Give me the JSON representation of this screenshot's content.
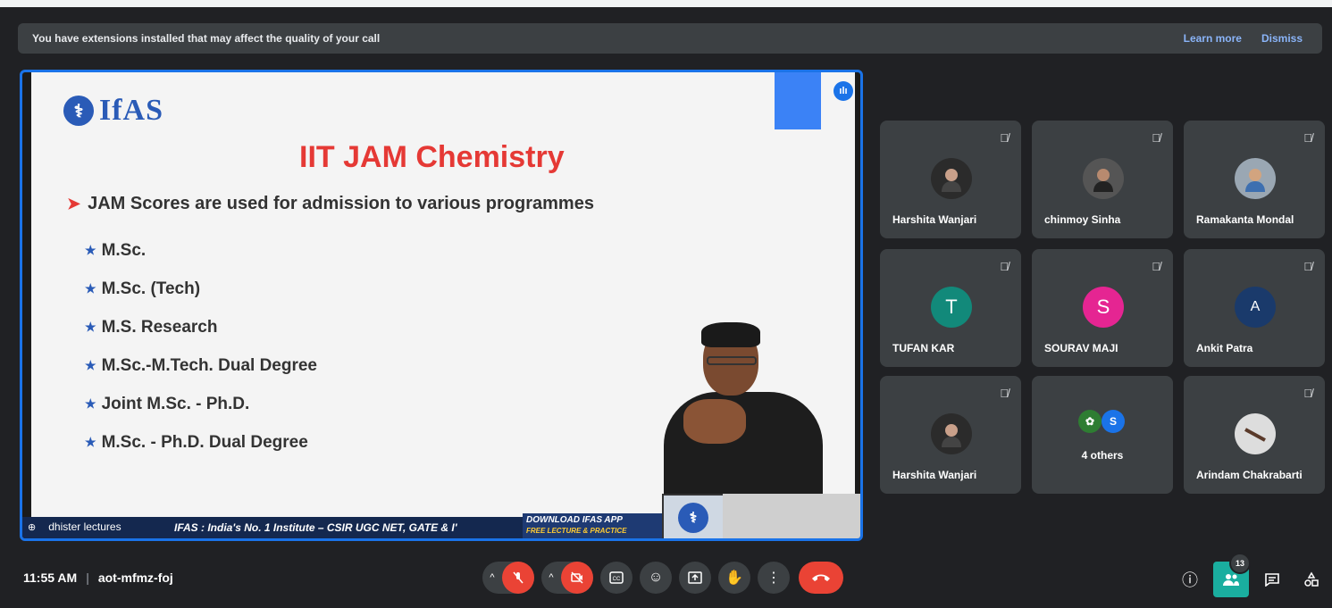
{
  "banner": {
    "message": "You have extensions installed that may affect the quality of your call",
    "learn_more": "Learn more",
    "dismiss": "Dismiss"
  },
  "presentation": {
    "logo_mark": "⚕",
    "logo_text": "IfAS",
    "title": "IIT JAM Chemistry",
    "lead": "JAM Scores are used for admission to various programmes",
    "bullets": [
      "M.Sc.",
      "M.Sc. (Tech)",
      "M.S. Research",
      "M.Sc.-M.Tech. Dual Degree",
      "Joint M.Sc. - Ph.D.",
      "M.Sc. - Ph.D. Dual Degree"
    ],
    "ticker": "IFAS : India's No. 1 Institute – CSIR UGC NET, GATE & I'",
    "app_line1": "DOWNLOAD IFAS APP",
    "app_line2": "FREE LECTURE & PRACTICE QUESTIONS",
    "presenter_name": "dhister lectures"
  },
  "participants": [
    {
      "name": "Harshita Wanjari",
      "avatar": "",
      "color": "#2b2b2b"
    },
    {
      "name": "chinmoy Sinha",
      "avatar": "",
      "color": "#555555"
    },
    {
      "name": "Ramakanta Mondal",
      "avatar": "",
      "color": "#9aa7b3"
    },
    {
      "name": "TUFAN KAR",
      "avatar": "T",
      "color": "#12897a"
    },
    {
      "name": "SOURAV MAJI",
      "avatar": "S",
      "color": "#e52592"
    },
    {
      "name": "Ankit Patra",
      "avatar": "A",
      "color": "#1a3a6b"
    },
    {
      "name": "Harshita Wanjari",
      "avatar": "",
      "color": "#2b2b2b"
    },
    {
      "name": "",
      "avatar": "",
      "color": "#3c4043",
      "others_label": "4 others",
      "mini_s": "S"
    },
    {
      "name": "Arindam Chakrabarti",
      "avatar": "",
      "color": "#dddddd"
    }
  ],
  "bottom": {
    "time": "11:55 AM",
    "separator": "|",
    "meeting_code": "aot-mfmz-foj",
    "participant_count": "13"
  },
  "icons": {
    "mic_off": "mic-off-icon",
    "cam_off": "camera-off-icon",
    "captions": "captions-icon",
    "emoji": "emoji-icon",
    "present": "present-icon",
    "hand": "raise-hand-icon",
    "more": "more-options-icon",
    "end": "end-call-icon",
    "info": "info-icon",
    "people": "people-icon",
    "chat": "chat-icon",
    "activities": "activities-icon"
  },
  "colors": {
    "accent": "#1a73e8",
    "end_call": "#ea4335",
    "active_tab": "#1aae9f"
  }
}
